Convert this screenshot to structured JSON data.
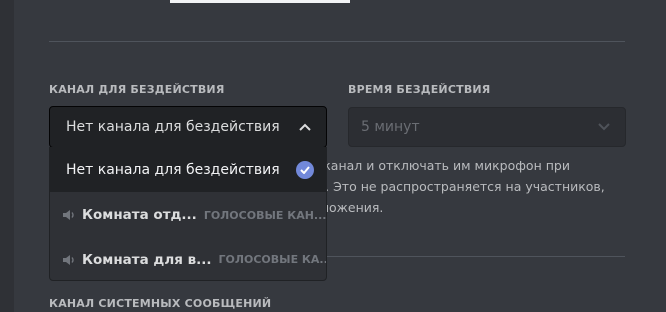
{
  "afk": {
    "channel_label": "КАНАЛ ДЛЯ БЕЗДЕЙСТВИЯ",
    "channel_value": "Нет канала для бездействия",
    "timeout_label": "ВРЕМЯ БЕЗДЕЙСТВИЯ",
    "timeout_value": "5 минут",
    "help_lines": [
      "т канал и отключать им микрофон при",
      "и. Это не распространяется на участников,",
      "ложения."
    ],
    "options": [
      {
        "name": "Нет канала для бездействия",
        "selected": true
      },
      {
        "name": "Комната отд...",
        "category": "ГОЛОСОВЫЕ КАН..."
      },
      {
        "name": "Комната для в...",
        "category": "ГОЛОСОВЫЕ КА..."
      }
    ]
  },
  "system_channel": {
    "label": "КАНАЛ СИСТЕМНЫХ СООБЩЕНИЙ"
  },
  "colors": {
    "background": "#36393f",
    "select_bg": "#202225",
    "dropdown_bg": "#2f3136",
    "accent": "#7289da"
  }
}
